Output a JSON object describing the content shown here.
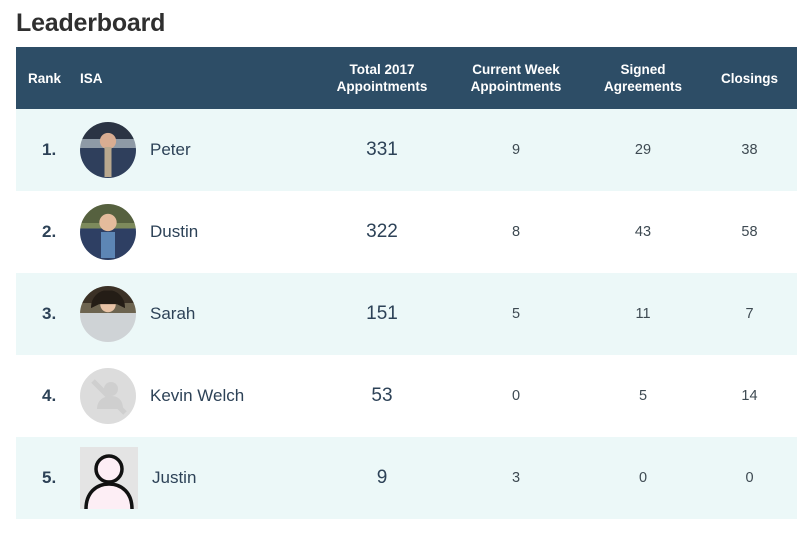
{
  "page": {
    "title": "Leaderboard"
  },
  "table": {
    "columns": [
      {
        "key": "rank",
        "label": "Rank"
      },
      {
        "key": "isa",
        "label": "ISA"
      },
      {
        "key": "total",
        "label": "Total 2017 Appointments"
      },
      {
        "key": "week",
        "label": "Current Week Appointments"
      },
      {
        "key": "signed",
        "label": "Signed Agreements"
      },
      {
        "key": "closings",
        "label": "Closings"
      }
    ],
    "column_labels": {
      "rank": "Rank",
      "isa": "ISA",
      "total_line1": "Total 2017",
      "total_line2": "Appointments",
      "week_line1": "Current Week",
      "week_line2": "Appointments",
      "signed_line1": "Signed",
      "signed_line2": "Agreements",
      "closings": "Closings"
    },
    "rows": [
      {
        "rank": "1.",
        "name": "Peter",
        "avatar": "photo-peter",
        "total_appointments": "331",
        "current_week_appointments": "9",
        "signed_agreements": "29",
        "closings": "38"
      },
      {
        "rank": "2.",
        "name": "Dustin",
        "avatar": "photo-dustin",
        "total_appointments": "322",
        "current_week_appointments": "8",
        "signed_agreements": "43",
        "closings": "58"
      },
      {
        "rank": "3.",
        "name": "Sarah",
        "avatar": "photo-sarah",
        "total_appointments": "151",
        "current_week_appointments": "5",
        "signed_agreements": "11",
        "closings": "7"
      },
      {
        "rank": "4.",
        "name": "Kevin Welch",
        "avatar": "no-photo-icon",
        "total_appointments": "53",
        "current_week_appointments": "0",
        "signed_agreements": "5",
        "closings": "14"
      },
      {
        "rank": "5.",
        "name": "Justin",
        "avatar": "person-placeholder-icon",
        "total_appointments": "9",
        "current_week_appointments": "3",
        "signed_agreements": "0",
        "closings": "0"
      }
    ]
  },
  "colors": {
    "header_bg": "#2d4d66",
    "header_text": "#ffffff",
    "stripe_row_bg": "#ecf8f8",
    "plain_row_bg": "#ffffff",
    "primary_text": "#2d4257",
    "secondary_text": "#3e4a52",
    "title_text": "#2f2f2f"
  }
}
